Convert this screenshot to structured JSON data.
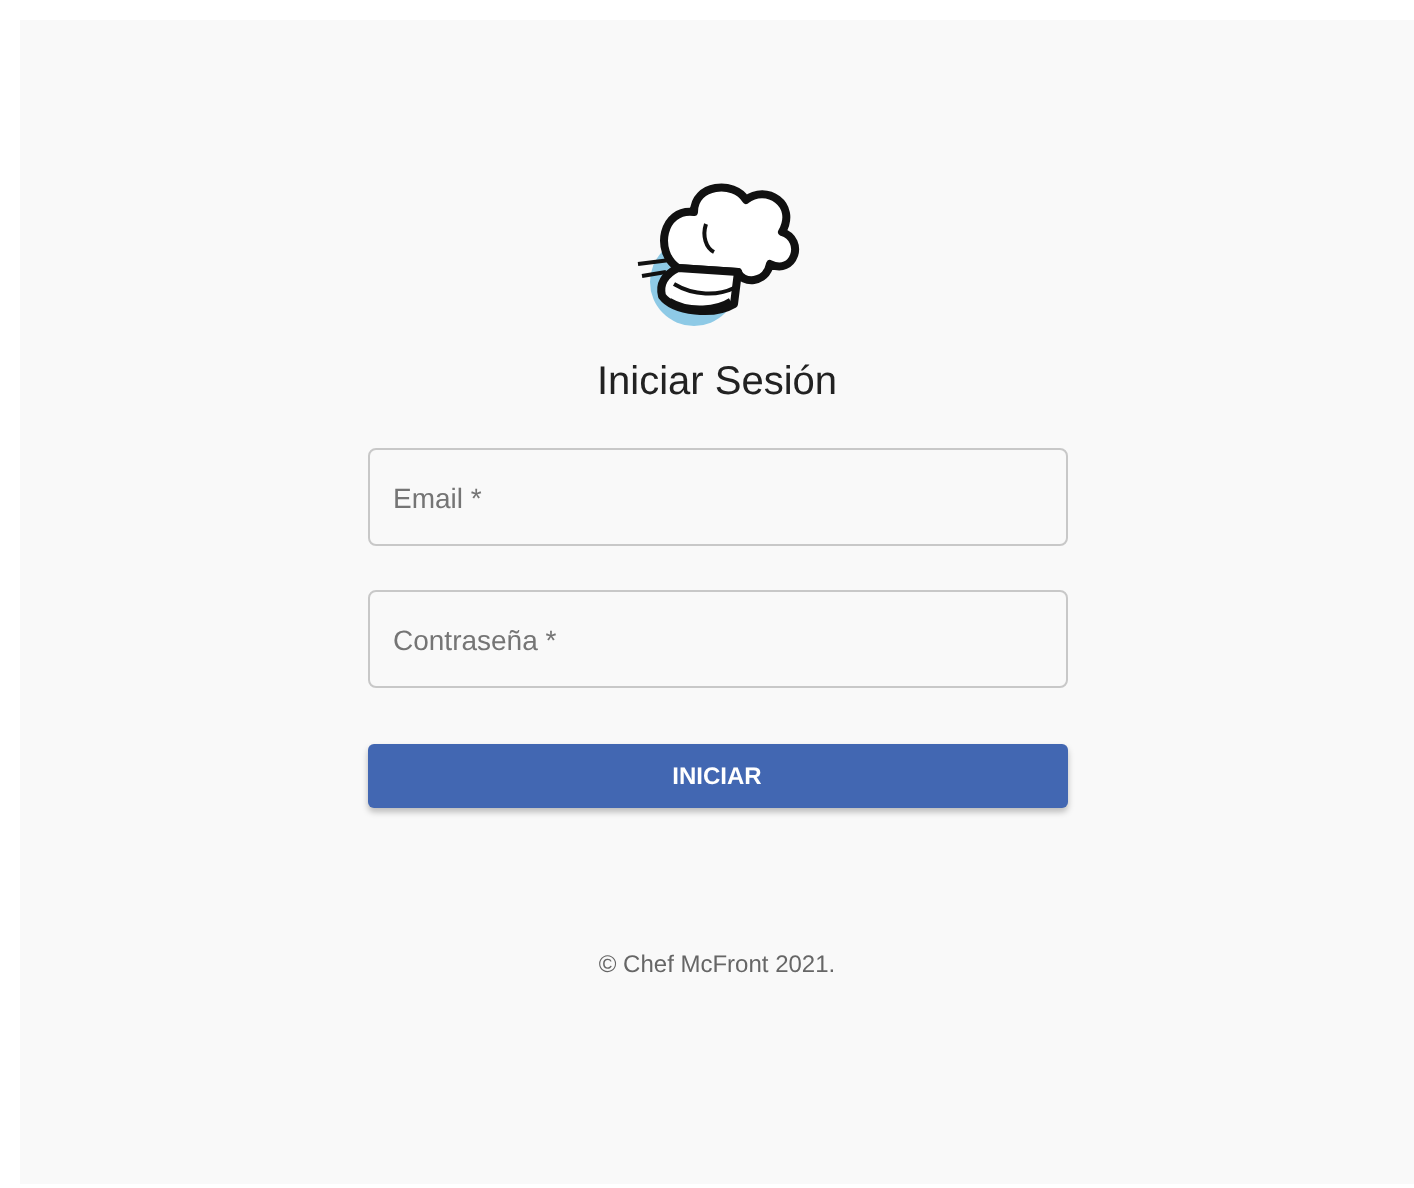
{
  "title": "Iniciar Sesión",
  "fields": [
    {
      "placeholder": "Email *"
    },
    {
      "placeholder": "Contraseña *"
    }
  ],
  "button": "INICIAR",
  "footer": "© Chef McFront 2021."
}
